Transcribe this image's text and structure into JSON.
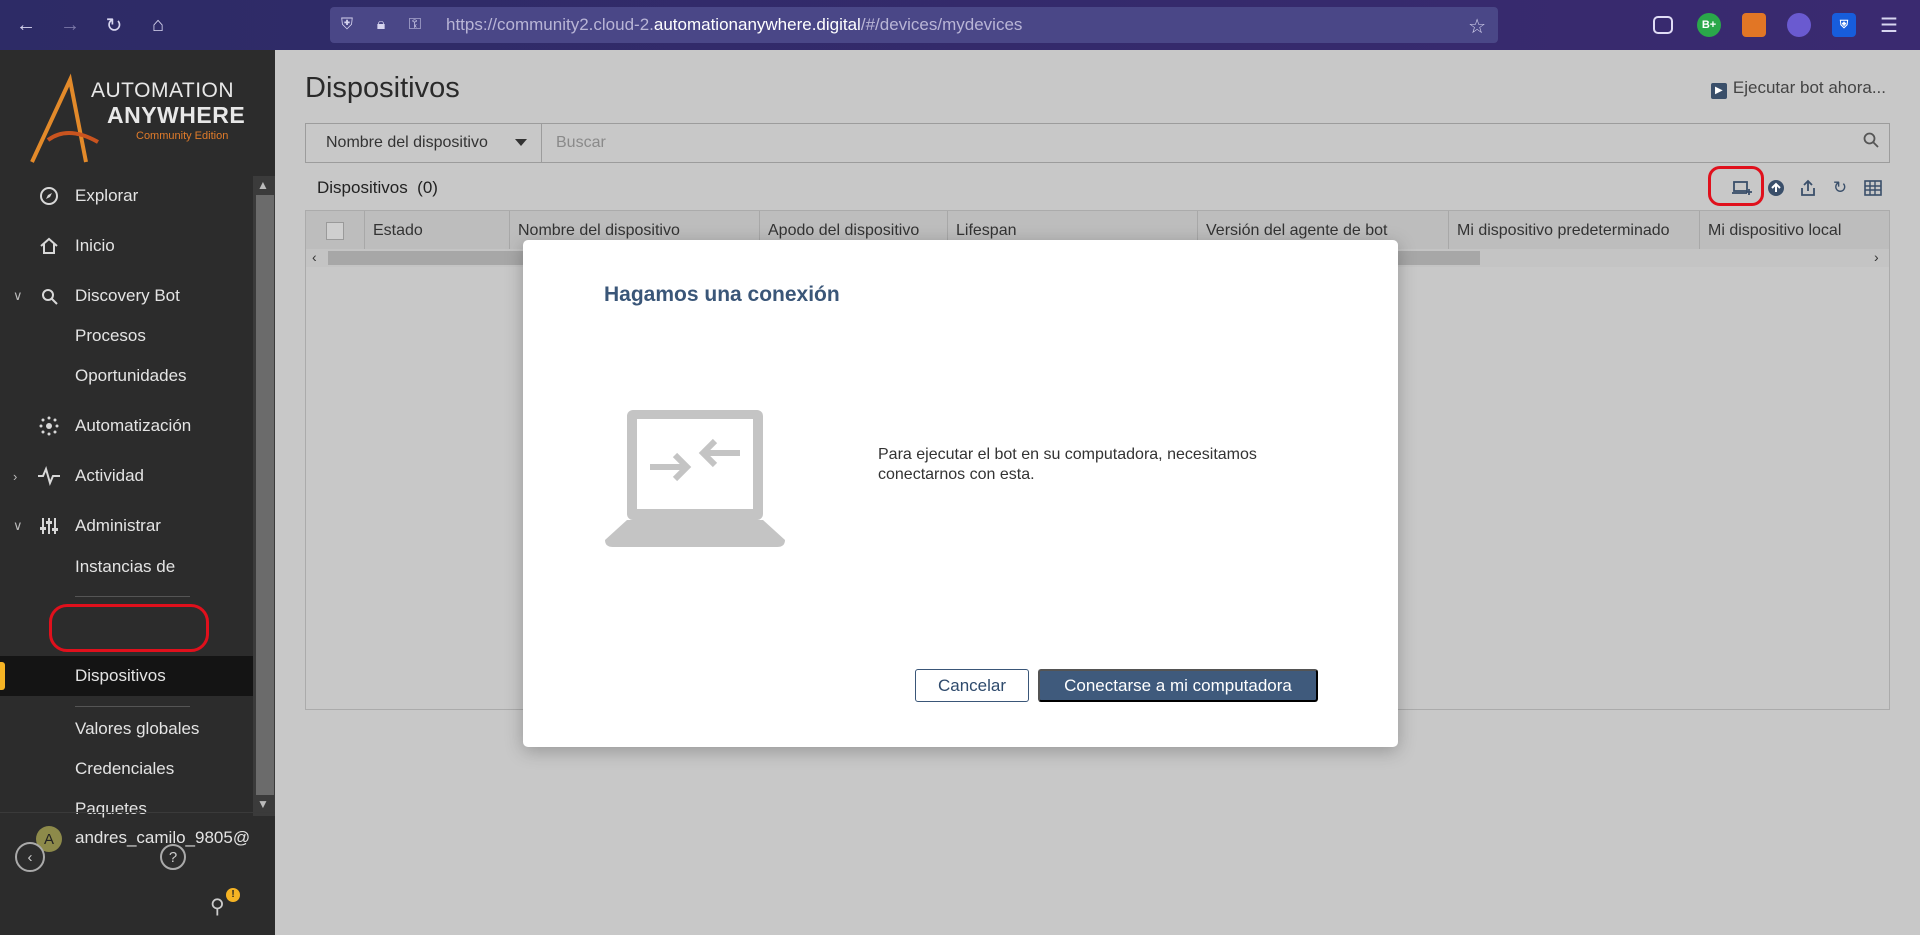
{
  "browser": {
    "url_prefix": "https://community2.cloud-2.",
    "url_domain": "automationanywhere.digital",
    "url_path": "/#/devices/mydevices",
    "back_icon": "arrow-left-icon",
    "forward_icon": "arrow-right-icon",
    "reload_icon": "reload-icon",
    "home_icon": "home-icon",
    "extensions": [
      "pocket-icon",
      "B+",
      "metamask-icon",
      "extension-icon",
      "bitwarden-icon"
    ]
  },
  "sidebar": {
    "logo": {
      "line1": "AUTOMATION",
      "line2": "ANYWHERE",
      "line3": "Community Edition"
    },
    "items": [
      {
        "label": "Explorar",
        "icon": "compass-icon"
      },
      {
        "label": "Inicio",
        "icon": "home-icon"
      },
      {
        "label": "Discovery Bot",
        "icon": "discovery-bot-icon"
      },
      {
        "label": "Procesos"
      },
      {
        "label": "Oportunidades"
      },
      {
        "label": "Automatización",
        "icon": "automation-icon"
      },
      {
        "label": "Actividad",
        "icon": "activity-icon"
      },
      {
        "label": "Administrar",
        "icon": "admin-sliders-icon"
      },
      {
        "label": "Instancias de"
      },
      {
        "label": "Dispositivos"
      },
      {
        "label": "Valores globales"
      },
      {
        "label": "Credenciales"
      },
      {
        "label": "Paquetes"
      }
    ],
    "user": {
      "initial": "A",
      "name": "andres_camilo_9805@"
    },
    "footer": {
      "collapse_icon": "collapse-icon",
      "help_icon": "help-icon",
      "notification_badge": "!"
    }
  },
  "main": {
    "title": "Dispositivos",
    "run_bot_label": "Ejecutar bot ahora...",
    "filter_select": "Nombre del dispositivo",
    "search_placeholder": "Buscar",
    "count_label": "Dispositivos",
    "count_value": "(0)",
    "columns": [
      "Estado",
      "Nombre del dispositivo",
      "Apodo del dispositivo",
      "Lifespan",
      "Versión del agente de bot",
      "Mi dispositivo predeterminado",
      "Mi dispositivo local"
    ]
  },
  "modal": {
    "title": "Hagamos una conexión",
    "message": "Para ejecutar el bot en su computadora, necesitamos conectarnos con esta.",
    "cancel_label": "Cancelar",
    "connect_label": "Conectarse a mi computadora"
  },
  "colors": {
    "accent": "#3f5a7c",
    "highlight": "#e0101c",
    "active_bar": "#f5b324"
  }
}
